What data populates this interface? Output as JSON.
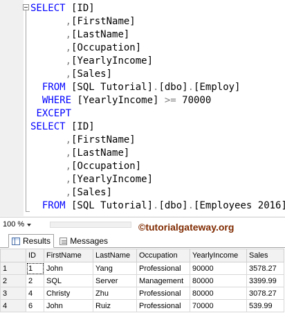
{
  "editor": {
    "lines": [
      {
        "indent": "",
        "parts": [
          {
            "t": "SELECT",
            "c": "kw"
          },
          {
            "t": " [ID]",
            "c": "txt"
          }
        ]
      },
      {
        "indent": "      ",
        "parts": [
          {
            "t": ",",
            "c": "op"
          },
          {
            "t": "[FirstName]",
            "c": "txt"
          }
        ]
      },
      {
        "indent": "      ",
        "parts": [
          {
            "t": ",",
            "c": "op"
          },
          {
            "t": "[LastName]",
            "c": "txt"
          }
        ]
      },
      {
        "indent": "      ",
        "parts": [
          {
            "t": ",",
            "c": "op"
          },
          {
            "t": "[Occupation]",
            "c": "txt"
          }
        ]
      },
      {
        "indent": "      ",
        "parts": [
          {
            "t": ",",
            "c": "op"
          },
          {
            "t": "[YearlyIncome]",
            "c": "txt"
          }
        ]
      },
      {
        "indent": "      ",
        "parts": [
          {
            "t": ",",
            "c": "op"
          },
          {
            "t": "[Sales]",
            "c": "txt"
          }
        ]
      },
      {
        "indent": "  ",
        "parts": [
          {
            "t": "FROM",
            "c": "kw"
          },
          {
            "t": " [SQL Tutorial]",
            "c": "txt"
          },
          {
            "t": ".",
            "c": "op"
          },
          {
            "t": "[dbo]",
            "c": "txt"
          },
          {
            "t": ".",
            "c": "op"
          },
          {
            "t": "[Employ]",
            "c": "txt"
          }
        ]
      },
      {
        "indent": "  ",
        "parts": [
          {
            "t": "WHERE",
            "c": "kw"
          },
          {
            "t": " [YearlyIncome] ",
            "c": "txt"
          },
          {
            "t": ">=",
            "c": "op"
          },
          {
            "t": " 70000",
            "c": "num"
          }
        ]
      },
      {
        "indent": " ",
        "parts": [
          {
            "t": "EXCEPT",
            "c": "kw"
          }
        ]
      },
      {
        "indent": "",
        "parts": [
          {
            "t": "SELECT",
            "c": "kw"
          },
          {
            "t": " [ID]",
            "c": "txt"
          }
        ]
      },
      {
        "indent": "      ",
        "parts": [
          {
            "t": ",",
            "c": "op"
          },
          {
            "t": "[FirstName]",
            "c": "txt"
          }
        ]
      },
      {
        "indent": "      ",
        "parts": [
          {
            "t": ",",
            "c": "op"
          },
          {
            "t": "[LastName]",
            "c": "txt"
          }
        ]
      },
      {
        "indent": "      ",
        "parts": [
          {
            "t": ",",
            "c": "op"
          },
          {
            "t": "[Occupation]",
            "c": "txt"
          }
        ]
      },
      {
        "indent": "      ",
        "parts": [
          {
            "t": ",",
            "c": "op"
          },
          {
            "t": "[YearlyIncome]",
            "c": "txt"
          }
        ]
      },
      {
        "indent": "      ",
        "parts": [
          {
            "t": ",",
            "c": "op"
          },
          {
            "t": "[Sales]",
            "c": "txt"
          }
        ]
      },
      {
        "indent": "  ",
        "parts": [
          {
            "t": "FROM",
            "c": "kw"
          },
          {
            "t": " [SQL Tutorial]",
            "c": "txt"
          },
          {
            "t": ".",
            "c": "op"
          },
          {
            "t": "[dbo]",
            "c": "txt"
          },
          {
            "t": ".",
            "c": "op"
          },
          {
            "t": "[Employees 2016]",
            "c": "txt"
          }
        ]
      }
    ]
  },
  "zoom": {
    "value": "100 %"
  },
  "watermark": "©tutorialgateway.org",
  "tabs": {
    "results": "Results",
    "messages": "Messages",
    "results_icon": "grid-icon",
    "messages_icon": "messages-icon"
  },
  "grid": {
    "columns": [
      "ID",
      "FirstName",
      "LastName",
      "Occupation",
      "YearlyIncome",
      "Sales"
    ],
    "rows": [
      {
        "n": "1",
        "cells": [
          "1",
          "John",
          "Yang",
          "Professional",
          "90000",
          "3578.27"
        ]
      },
      {
        "n": "2",
        "cells": [
          "2",
          "SQL",
          "Server",
          "Management",
          "80000",
          "3399.99"
        ]
      },
      {
        "n": "3",
        "cells": [
          "4",
          "Christy",
          "Zhu",
          "Professional",
          "80000",
          "3078.27"
        ]
      },
      {
        "n": "4",
        "cells": [
          "6",
          "John",
          "Ruiz",
          "Professional",
          "70000",
          "539.99"
        ]
      }
    ]
  },
  "colors": {
    "keyword": "#0000ff",
    "operator": "#808080",
    "watermark": "#7f2a00"
  }
}
